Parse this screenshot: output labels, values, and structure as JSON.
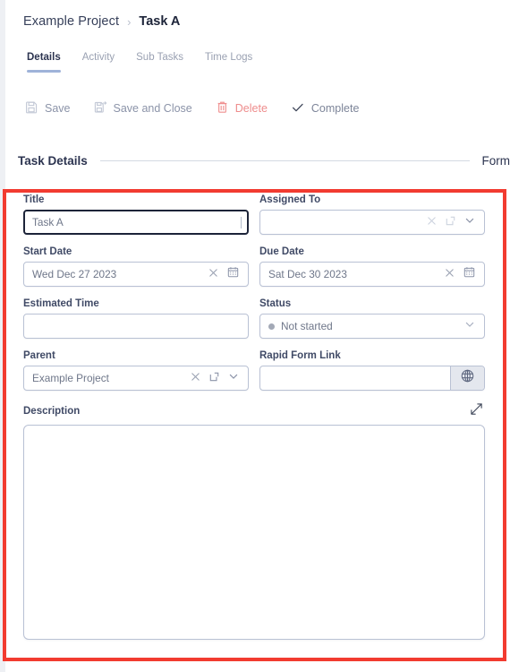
{
  "breadcrumb": {
    "parent": "Example Project",
    "separator": "›",
    "current": "Task A"
  },
  "tabs": [
    {
      "label": "Details",
      "active": true
    },
    {
      "label": "Activity",
      "active": false
    },
    {
      "label": "Sub Tasks",
      "active": false
    },
    {
      "label": "Time Logs",
      "active": false
    }
  ],
  "toolbar": {
    "save_label": "Save",
    "save_icon": "floppy-disk-icon",
    "save_and_close_label": "Save and Close",
    "save_and_close_icon": "floppy-disk-arrow-icon",
    "delete_label": "Delete",
    "delete_icon": "trash-icon",
    "complete_label": "Complete",
    "complete_icon": "check-icon"
  },
  "section": {
    "title": "Task Details",
    "right_title": "Form"
  },
  "fields": {
    "title": {
      "label": "Title",
      "value": "Task A",
      "focused": true
    },
    "assigned_to": {
      "label": "Assigned To",
      "value": "",
      "placeholder": "",
      "icons": [
        "clear-x-icon",
        "popout-icon",
        "chevron-down-icon"
      ]
    },
    "start_date": {
      "label": "Start Date",
      "value": "Wed Dec 27 2023",
      "icons": [
        "clear-x-icon",
        "calendar-icon"
      ]
    },
    "due_date": {
      "label": "Due Date",
      "value": "Sat Dec 30 2023",
      "icons": [
        "clear-x-icon",
        "calendar-icon"
      ]
    },
    "estimated_time": {
      "label": "Estimated Time",
      "value": ""
    },
    "status": {
      "label": "Status",
      "value": "Not started",
      "dot_color": "#a3a9b6",
      "icons": [
        "chevron-down-icon"
      ]
    },
    "parent": {
      "label": "Parent",
      "value": "Example Project",
      "icons": [
        "clear-x-icon",
        "popout-icon",
        "chevron-down-icon"
      ]
    },
    "rapid_form_link": {
      "label": "Rapid Form Link",
      "value": "",
      "button_icon": "globe-icon"
    },
    "description": {
      "label": "Description",
      "value": "",
      "expand_icon": "expand-diagonal-icon"
    }
  },
  "colors": {
    "accent_tab_underline": "#9fb3d9",
    "delete_red": "#ee8c8c",
    "annotation_red": "#f23b30",
    "label_text": "#404a66",
    "page_bg": "#eef0f4"
  }
}
